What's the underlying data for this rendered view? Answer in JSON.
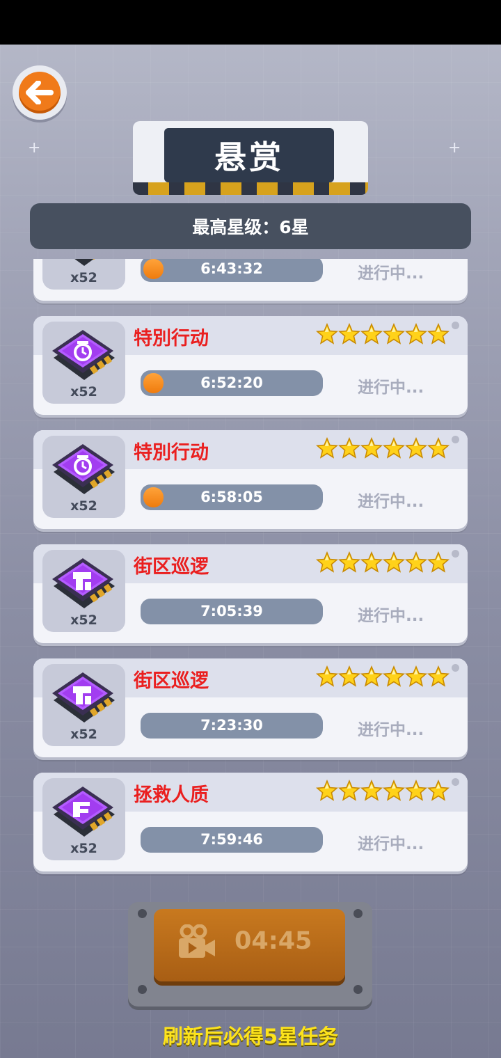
{
  "screen": {
    "title": "悬赏",
    "max_star_text": "最高星级：6星",
    "refresh_timer": "04:45",
    "refresh_hint": "刷新后必得5星任务"
  },
  "tasks": [
    {
      "name": "",
      "reward_qty": "x52",
      "timer": "6:43:32",
      "status": "进行中...",
      "stars": 6,
      "progress": 0.1,
      "chip": "timer-chip"
    },
    {
      "name": "特別行动",
      "reward_qty": "x52",
      "timer": "6:52:20",
      "status": "进行中...",
      "stars": 6,
      "progress": 0.1,
      "chip": "timer-chip"
    },
    {
      "name": "特別行动",
      "reward_qty": "x52",
      "timer": "6:58:05",
      "status": "进行中...",
      "stars": 6,
      "progress": 0.1,
      "chip": "timer-chip"
    },
    {
      "name": "街区巡逻",
      "reward_qty": "x52",
      "timer": "7:05:39",
      "status": "进行中...",
      "stars": 6,
      "progress": 0,
      "chip": "patrol-chip"
    },
    {
      "name": "街区巡逻",
      "reward_qty": "x52",
      "timer": "7:23:30",
      "status": "进行中...",
      "stars": 6,
      "progress": 0,
      "chip": "patrol-chip"
    },
    {
      "name": "拯救人质",
      "reward_qty": "x52",
      "timer": "7:59:46",
      "status": "进行中...",
      "stars": 6,
      "progress": 0,
      "chip": "rescue-chip"
    }
  ],
  "colors": {
    "task_name": "#ea1f1f",
    "progress_fill": "#ef7b0d",
    "hint": "#fde31c",
    "chip_purple": "#a23df0"
  }
}
